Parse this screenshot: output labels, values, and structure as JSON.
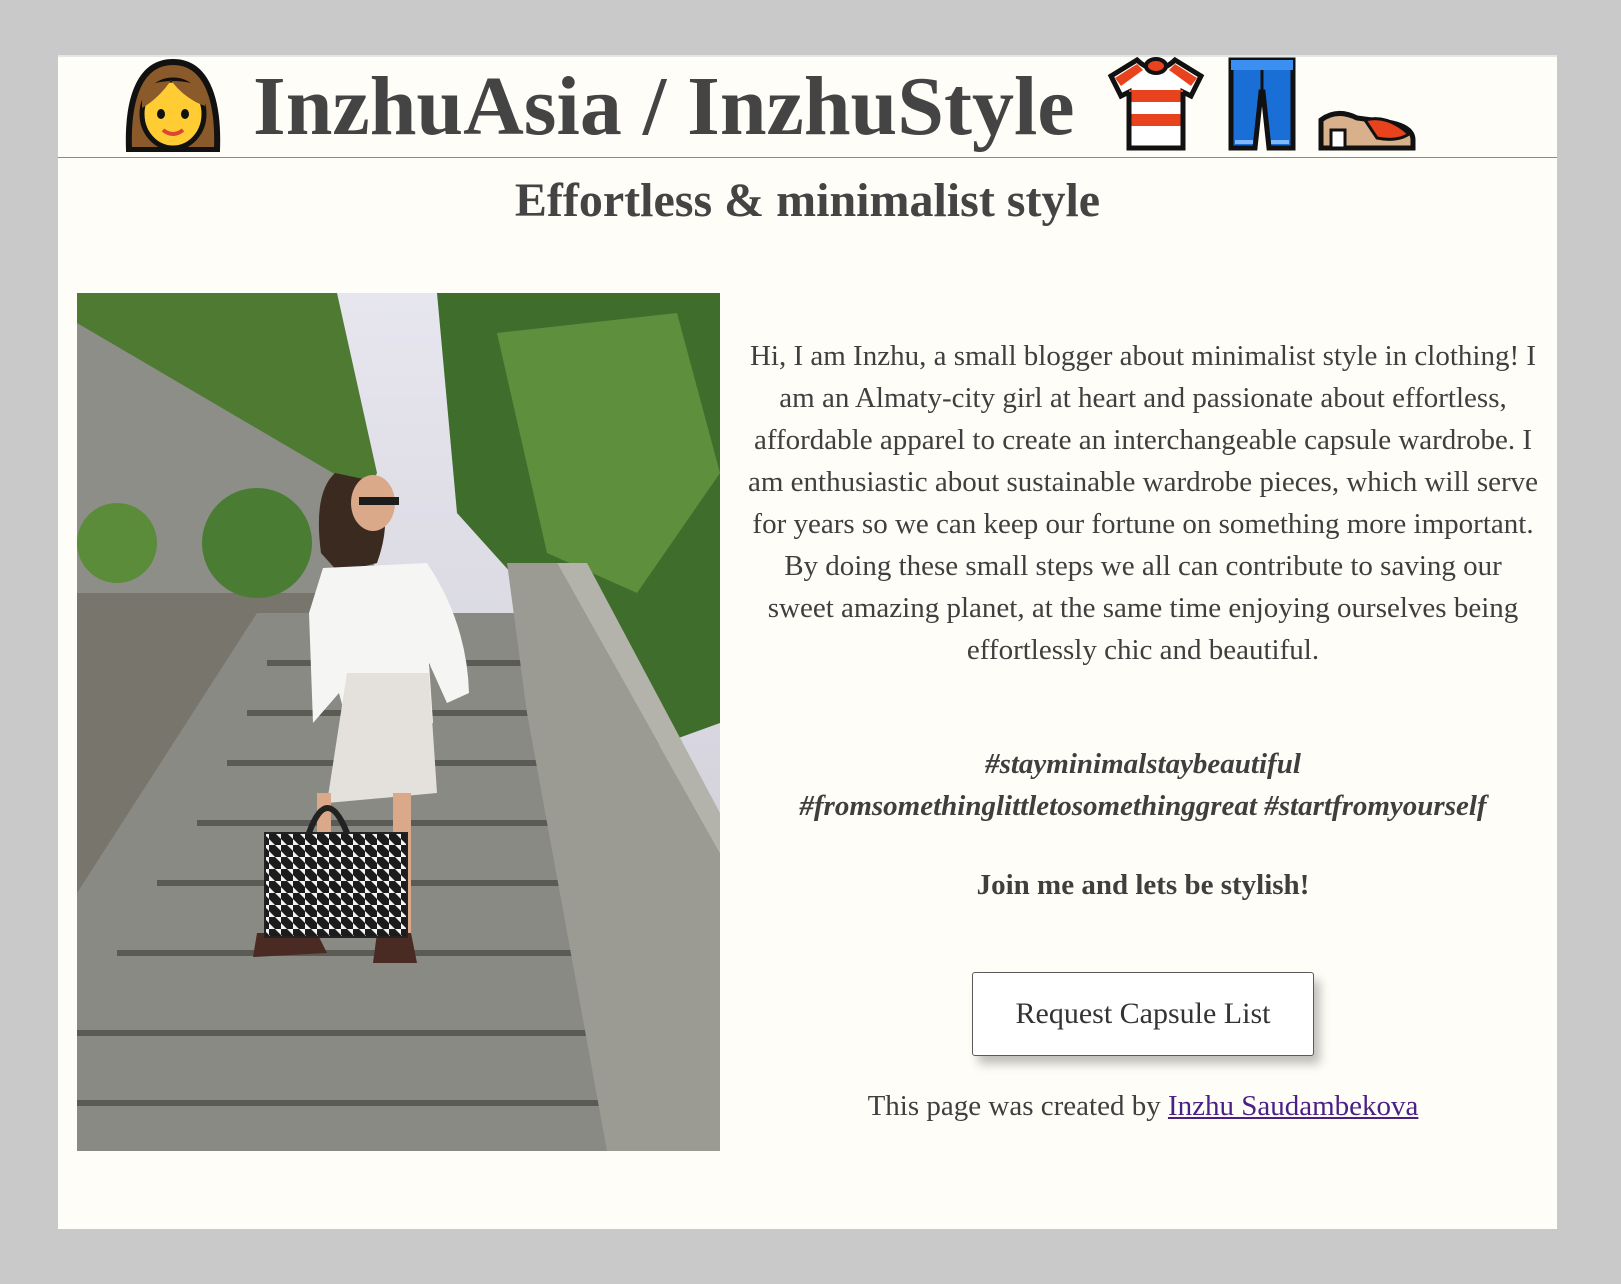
{
  "header": {
    "title": "InzhuAsia / InzhuStyle",
    "icons": [
      "woman-icon",
      "tshirt-icon",
      "jeans-icon",
      "flat-shoe-icon"
    ]
  },
  "subtitle": "Effortless & minimalist style",
  "photo": {
    "alt": "Woman in white shirt and shorts with houndstooth bag on stone stairs"
  },
  "intro": "Hi, I am Inzhu, a small blogger about minimalist style in clothing! I am an Almaty-city girl at heart and passionate about effortless, affordable apparel to create an interchangeable capsule wardrobe. I am enthusiastic about sustainable wardrobe pieces, which will serve for years so we can keep our fortune on something more important. By doing these small steps we all can contribute to saving our sweet amazing planet, at the same time enjoying ourselves being effortlessly chic and beautiful.",
  "hashtags": {
    "line1": "#stayminimalstaybeautiful",
    "line2": "#fromsomethinglittletosomethinggreat #startfromyourself"
  },
  "join_text": "Join me and lets be stylish!",
  "cta_button": "Request Capsule List",
  "footer": {
    "prefix": "This page was created by ",
    "author_link": "Inzhu Saudambekova"
  },
  "colors": {
    "page_background": "#fffdf7",
    "outer_background": "#c9c9c9",
    "text": "#3f3f3f",
    "link": "#4a1f86"
  }
}
